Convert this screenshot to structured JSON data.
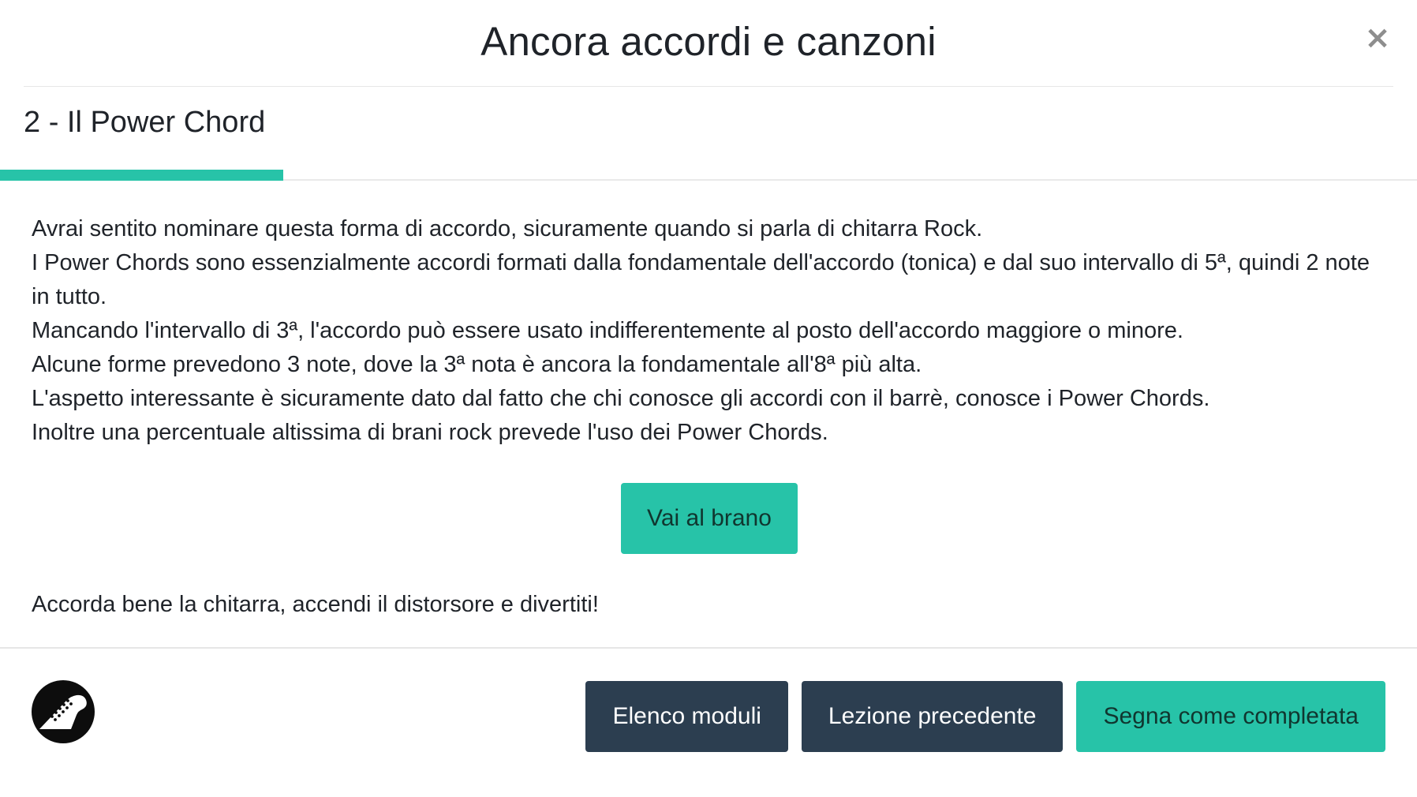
{
  "modal": {
    "title": "Ancora accordi e canzoni",
    "close_label": "×"
  },
  "lesson": {
    "heading": "2 - Il Power Chord"
  },
  "body": {
    "lines": [
      "Avrai sentito nominare questa forma di accordo, sicuramente quando si parla di chitarra Rock.",
      "I Power Chords sono essenzialmente accordi formati dalla fondamentale dell'accordo (tonica) e dal suo intervallo di 5ª, quindi 2 note in tutto.",
      "Mancando l'intervallo di 3ª, l'accordo può essere usato indifferentemente al posto dell'accordo maggiore o minore.",
      "Alcune forme prevedono 3 note, dove la 3ª nota è ancora la fondamentale all'8ª più alta.",
      "L'aspetto interessante è sicuramente dato dal fatto che chi conosce gli accordi con il barrè, conosce i Power Chords.",
      "Inoltre una percentuale altissima di brani rock prevede l'uso dei Power Chords."
    ],
    "cta_label": "Vai al brano",
    "closing": "Accorda bene la chitarra, accendi il distorsore e divertiti!"
  },
  "footer": {
    "logo_icon": "guitar-headstock-icon",
    "buttons": {
      "modules": "Elenco moduli",
      "previous": "Lezione precedente",
      "complete": "Segna come completata"
    }
  },
  "colors": {
    "accent": "#27c3a8",
    "dark_button": "#2c3e50",
    "text": "#1f2329"
  }
}
